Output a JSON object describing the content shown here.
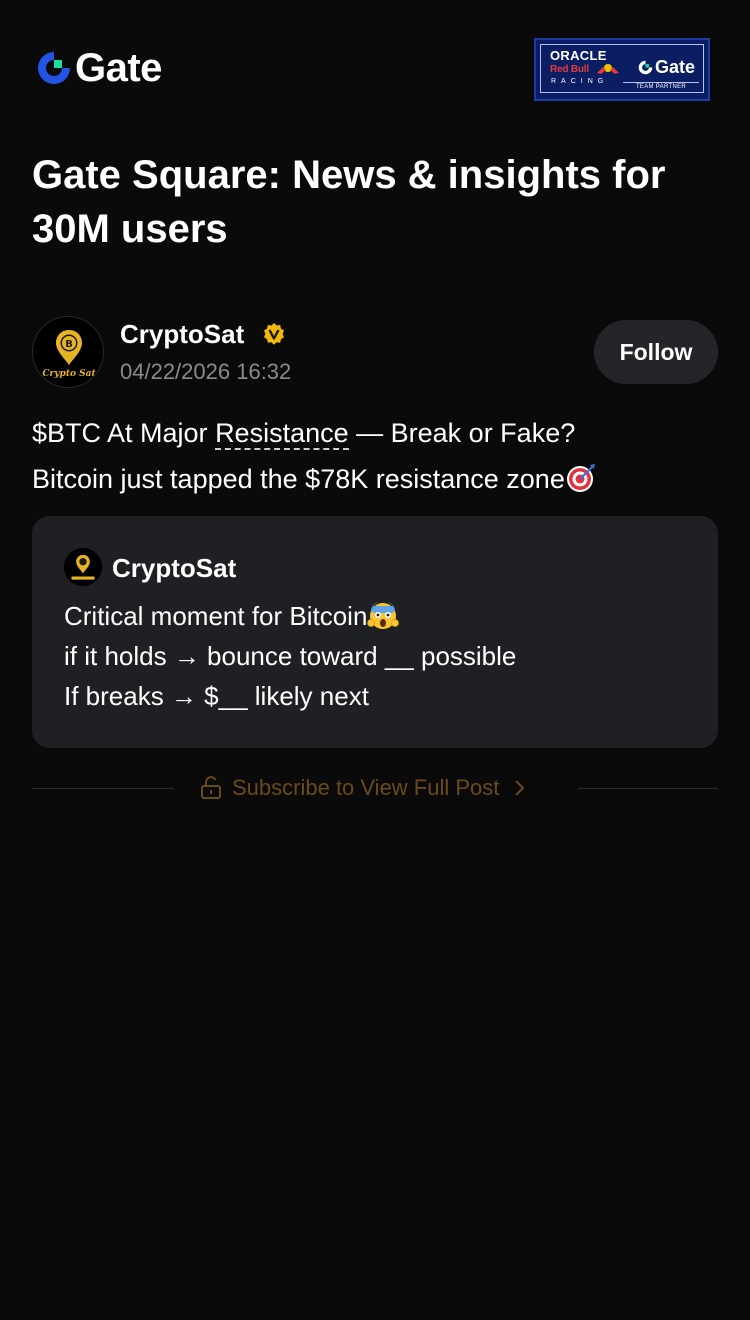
{
  "header": {
    "brand": "Gate",
    "partner": {
      "oracle": "ORACLE",
      "redbull": "Red Bull",
      "racing": "RACING",
      "gate": "Gate",
      "team": "TEAM PARTNER"
    }
  },
  "page_title": "Gate Square: News & insights for 30M users",
  "post": {
    "author": "CryptoSat",
    "avatar_text": "Crypto Sat",
    "avatar_letter": "B",
    "timestamp": "04/22/2026 16:32",
    "follow_label": "Follow",
    "line1_prefix": "$BTC At Major ",
    "line1_link": "Resistance",
    "line1_suffix": " — Break or Fake?",
    "line2": "Bitcoin just tapped the $78K resistance zone"
  },
  "quote": {
    "author": "CryptoSat",
    "line1": "Critical moment for Bitcoin",
    "line2": "if it holds → bounce toward __ possible",
    "line3": "If breaks → $__ likely next"
  },
  "subscribe_label": "Subscribe to View Full Post",
  "colors": {
    "background": "#0a0a0b",
    "card": "#1f2024",
    "button": "#242528",
    "accent_brand": "#2354e6",
    "accent_mark": "#17e0a0",
    "verified": "#f0b90b",
    "subscribe": "#6a4a1c",
    "muted": "#8a8a8e"
  }
}
